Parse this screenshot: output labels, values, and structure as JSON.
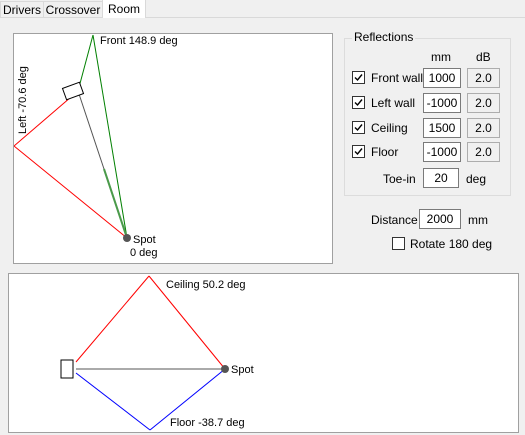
{
  "tabs": [
    "Drivers",
    "Crossover",
    "Room"
  ],
  "active_tab": "Room",
  "plan_view": {
    "front_label": "Front 148.9 deg",
    "left_label": "Left -70.6 deg",
    "spot_label": "Spot",
    "angle_label": "0 deg"
  },
  "side_view": {
    "ceiling_label": "Ceiling 50.2 deg",
    "floor_label": "Floor -38.7 deg",
    "spot_label": "Spot"
  },
  "reflections": {
    "title": "Reflections",
    "col_mm": "mm",
    "col_db": "dB",
    "rows": [
      {
        "label": "Front wall",
        "checked": true,
        "mm": "1000",
        "db": "2.0"
      },
      {
        "label": "Left wall",
        "checked": true,
        "mm": "-1000",
        "db": "2.0"
      },
      {
        "label": "Ceiling",
        "checked": true,
        "mm": "1500",
        "db": "2.0"
      },
      {
        "label": "Floor",
        "checked": true,
        "mm": "-1000",
        "db": "2.0"
      }
    ],
    "toein_label": "Toe-in",
    "toein_value": "20",
    "toein_unit": "deg"
  },
  "distance": {
    "label": "Distance",
    "value": "2000",
    "unit": "mm"
  },
  "rotate": {
    "label": "Rotate 180 deg",
    "checked": false
  },
  "colors": {
    "reflect_red": "#ff0000",
    "front_green": "#008000",
    "floor_blue": "#0000ff",
    "direct_gray": "#555555"
  }
}
